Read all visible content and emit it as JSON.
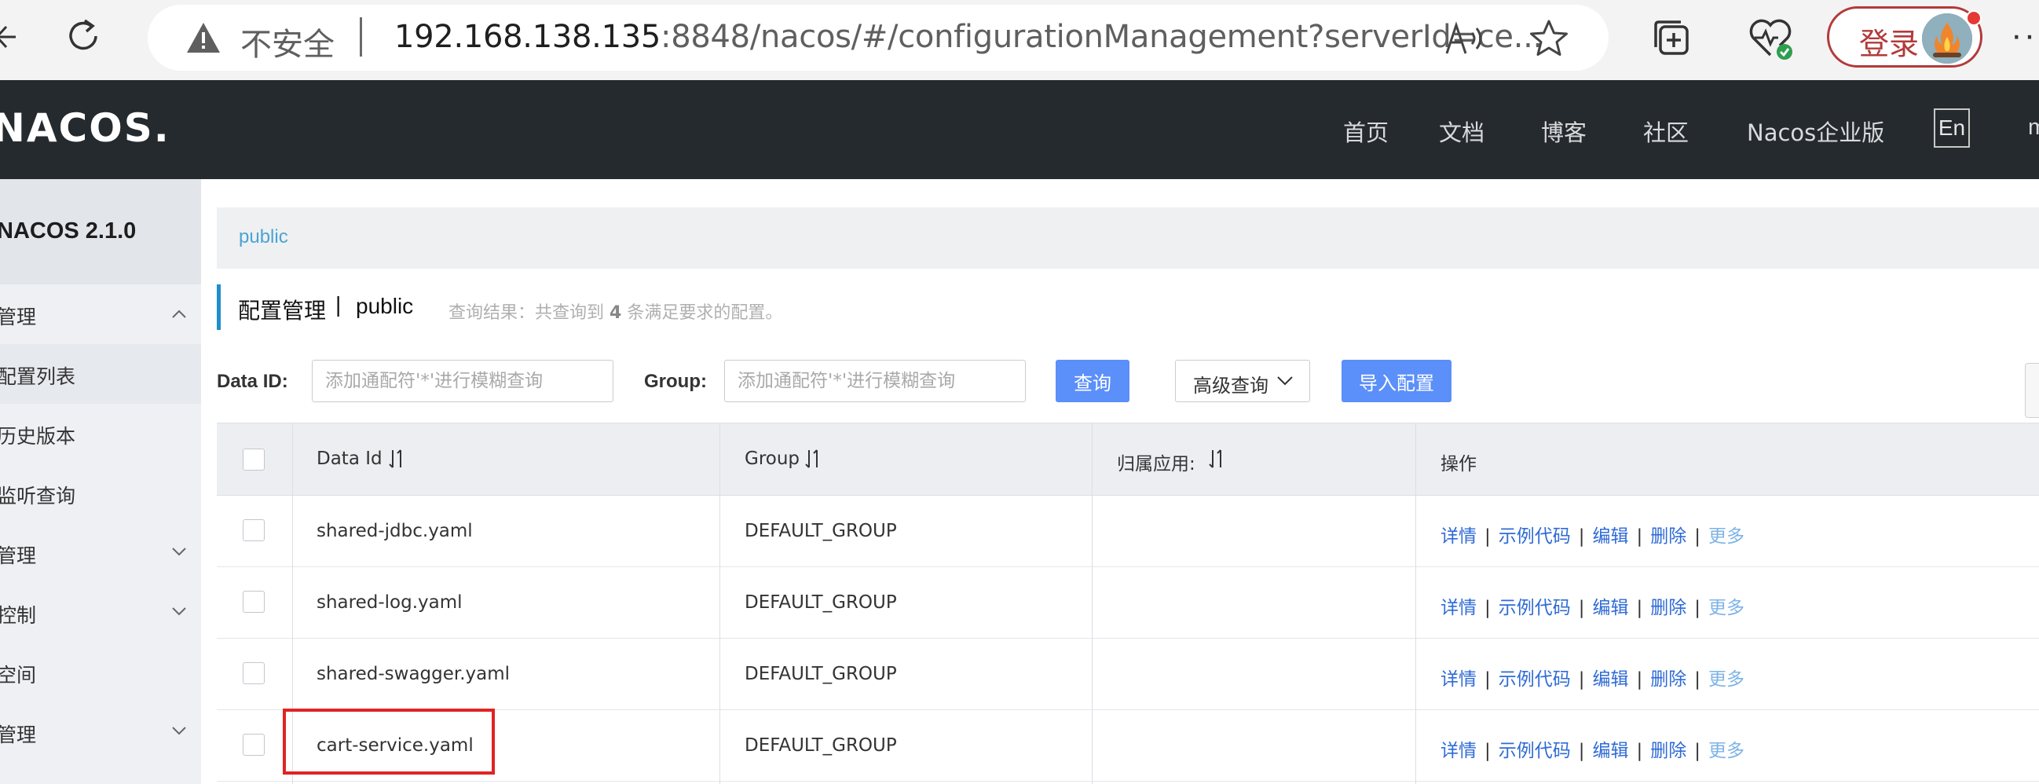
{
  "browser": {
    "security_label": "不安全",
    "url_host": "192.168.138.135",
    "url_rest": ":8848/nacos/#/configurationManagement?serverId=ce...",
    "login_label": "登录"
  },
  "header": {
    "logo": "NACOS.",
    "nav": [
      "首页",
      "文档",
      "博客",
      "社区",
      "Nacos企业版"
    ],
    "lang": "En",
    "cut_item": "m"
  },
  "sidebar": {
    "version": "NACOS 2.1.0",
    "items": [
      {
        "label": "管理",
        "chevron": "up"
      },
      {
        "label": "配置列表",
        "chevron": "",
        "active": true
      },
      {
        "label": "历史版本",
        "chevron": ""
      },
      {
        "label": "监听查询",
        "chevron": ""
      },
      {
        "label": "管理",
        "chevron": "down"
      },
      {
        "label": "控制",
        "chevron": "down"
      },
      {
        "label": "空间",
        "chevron": ""
      },
      {
        "label": "管理",
        "chevron": "down"
      }
    ]
  },
  "namespace_tab": "public",
  "title": {
    "main": "配置管理",
    "separator": "|",
    "namespace": "public",
    "result_prefix": "查询结果：共查询到",
    "result_count": "4",
    "result_suffix": "条满足要求的配置。"
  },
  "filters": {
    "data_id_label": "Data ID:",
    "data_id_placeholder": "添加通配符'*'进行模糊查询",
    "group_label": "Group:",
    "group_placeholder": "添加通配符'*'进行模糊查询",
    "search_button": "查询",
    "advanced_button": "高级查询",
    "import_button": "导入配置"
  },
  "table": {
    "headers": {
      "data_id": "Data Id",
      "group": "Group",
      "app": "归属应用:",
      "ops": "操作"
    },
    "actions": [
      "详情",
      "示例代码",
      "编辑",
      "删除",
      "更多"
    ],
    "rows": [
      {
        "data_id": "shared-jdbc.yaml",
        "group": "DEFAULT_GROUP",
        "app": ""
      },
      {
        "data_id": "shared-log.yaml",
        "group": "DEFAULT_GROUP",
        "app": ""
      },
      {
        "data_id": "shared-swagger.yaml",
        "group": "DEFAULT_GROUP",
        "app": ""
      },
      {
        "data_id": "cart-service.yaml",
        "group": "DEFAULT_GROUP",
        "app": ""
      }
    ]
  },
  "colors": {
    "header_bg": "#252a2f",
    "primary": "#5b8ff9",
    "link": "#2f6bd6",
    "highlight": "#e02424"
  }
}
